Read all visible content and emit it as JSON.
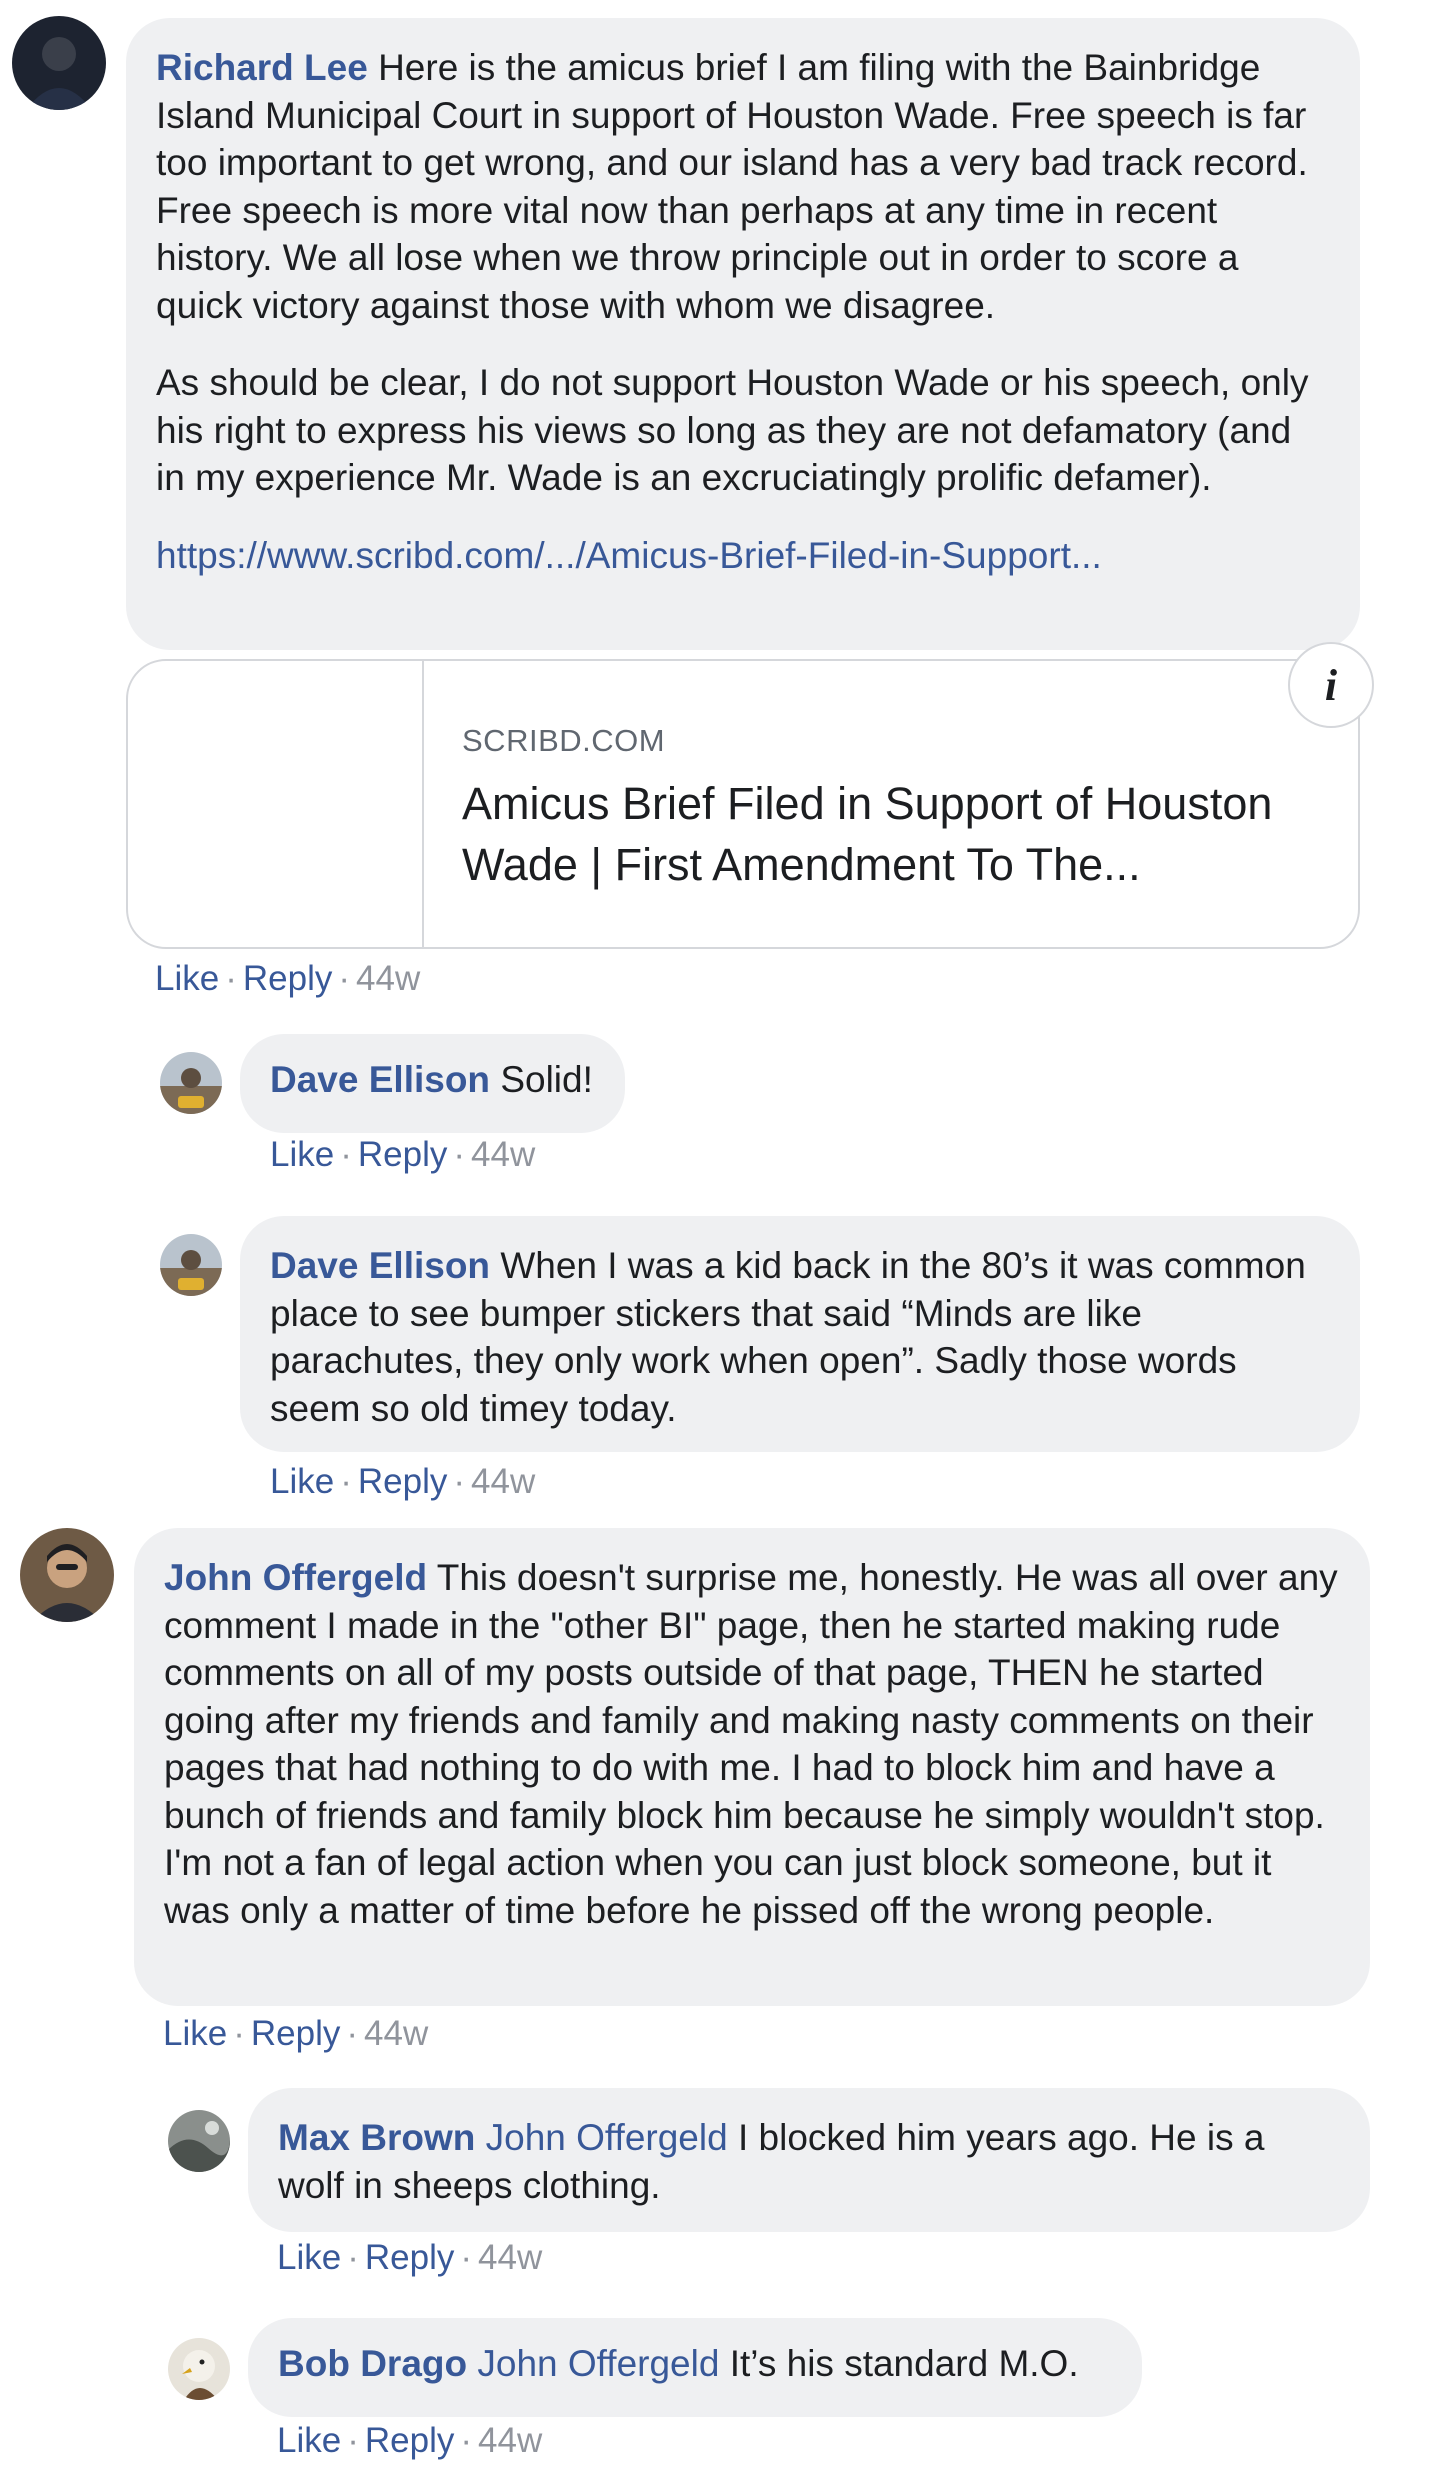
{
  "comments": [
    {
      "author": "Richard Lee",
      "paragraphs": [
        "Here is the amicus brief I am filing with the Bainbridge Island Municipal Court in support of Houston Wade. Free speech is far too important to get wrong, and our island has a very bad track record. Free speech is more vital now than perhaps at any time in recent history. We all lose when we throw principle out in order to score a quick victory against those with whom we disagree.",
        "As should be clear, I do not support Houston Wade or his speech, only his right to express his views so long as they are not defamatory (and in my experience Mr. Wade is an excruciatingly prolific defamer)."
      ],
      "link": "https://www.scribd.com/.../Amicus-Brief-Filed-in-Support...",
      "preview": {
        "domain": "SCRIBD.COM",
        "title": "Amicus Brief Filed in Support of Houston Wade | First Amendment To The..."
      },
      "actions": {
        "like": "Like",
        "reply": "Reply",
        "time": "44w"
      }
    },
    {
      "author": "Dave Ellison",
      "text": "Solid!",
      "actions": {
        "like": "Like",
        "reply": "Reply",
        "time": "44w"
      }
    },
    {
      "author": "Dave Ellison",
      "text": "When I was a kid back in the 80’s it was common place to see bumper stickers that said “Minds are like parachutes, they only work when open”. Sadly those words seem so old timey today.",
      "actions": {
        "like": "Like",
        "reply": "Reply",
        "time": "44w"
      }
    },
    {
      "author": "John Offergeld",
      "text": "This doesn't surprise me, honestly. He was all over any comment I made in the \"other BI\" page, then he started making rude comments on all of my posts outside of that page, THEN he started going after my friends and family and making nasty comments on their pages that had nothing to do with me. I had to block him and have a bunch of friends and family block him because he simply wouldn't stop. I'm not a fan of legal action when you can just block someone, but it was only a matter of time before he pissed off the wrong people.",
      "actions": {
        "like": "Like",
        "reply": "Reply",
        "time": "44w"
      }
    },
    {
      "author": "Max Brown",
      "mention": "John Offergeld",
      "text": "I blocked him years ago. He is a wolf in sheeps clothing.",
      "actions": {
        "like": "Like",
        "reply": "Reply",
        "time": "44w"
      }
    },
    {
      "author": "Bob Drago",
      "mention": "John Offergeld",
      "text": "It’s his standard M.O.",
      "actions": {
        "like": "Like",
        "reply": "Reply",
        "time": "44w"
      }
    }
  ],
  "icons": {
    "info": "info-icon",
    "separator": "·"
  },
  "colors": {
    "link": "#385898",
    "bubble": "#eff0f2",
    "meta": "#90949c"
  }
}
